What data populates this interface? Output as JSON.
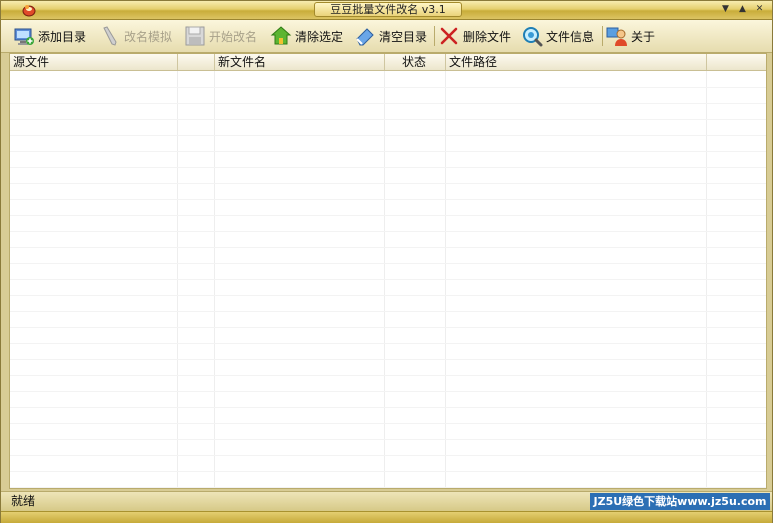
{
  "window": {
    "title": "豆豆批量文件改名 v3.1"
  },
  "toolbar": {
    "items": [
      {
        "label": "添加目录",
        "icon": "add-folder-icon",
        "enabled": true
      },
      {
        "label": "改名模拟",
        "icon": "pencil-icon",
        "enabled": false
      },
      {
        "label": "开始改名",
        "icon": "save-disk-icon",
        "enabled": false
      },
      {
        "label": "清除选定",
        "icon": "clear-selected-icon",
        "enabled": true
      },
      {
        "label": "清空目录",
        "icon": "eraser-icon",
        "enabled": true
      },
      {
        "label": "删除文件",
        "icon": "delete-x-icon",
        "enabled": true
      },
      {
        "label": "文件信息",
        "icon": "magnifier-icon",
        "enabled": true
      },
      {
        "label": "关于",
        "icon": "about-icon",
        "enabled": true
      }
    ]
  },
  "list": {
    "columns": [
      {
        "label": "源文件"
      },
      {
        "label": ""
      },
      {
        "label": "新文件名"
      },
      {
        "label": "状态"
      },
      {
        "label": "文件路径"
      }
    ],
    "rows": []
  },
  "status": {
    "text": "就绪"
  },
  "watermark": {
    "text": "JZ5U绿色下载站www.jz5u.com"
  },
  "colors": {
    "title_gold": "#e5cf6e",
    "frame": "#d8cc95",
    "watermark_bg": "#2c6fb4",
    "delete_red": "#cc2222"
  }
}
